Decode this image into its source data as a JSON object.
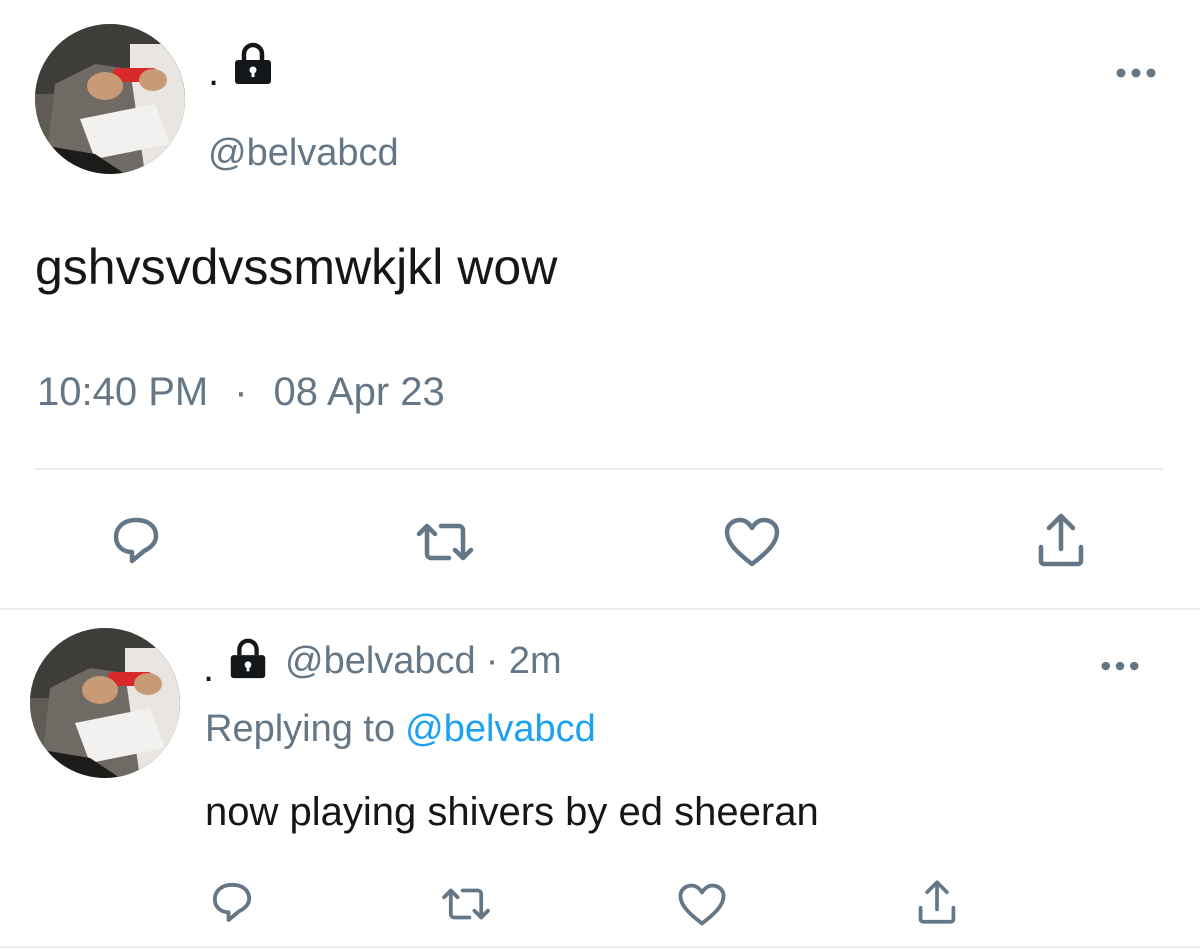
{
  "main_tweet": {
    "display_name": ".",
    "handle": "@belvabcd",
    "text": "gshvsvdvssmwkjkl wow",
    "time": "10:40 PM",
    "separator": "·",
    "date": "08 Apr 23",
    "icons": {
      "lock": "lock-icon",
      "more": "more-icon",
      "reply": "reply-icon",
      "retweet": "retweet-icon",
      "like": "heart-icon",
      "share": "share-icon"
    }
  },
  "reply_tweet": {
    "display_name": ".",
    "handle": "@belvabcd",
    "age": "· 2m",
    "replying_prefix": "Replying to",
    "replying_handle": "@belvabcd",
    "text": "now playing shivers by ed sheeran"
  },
  "colors": {
    "text": "#14171a",
    "muted": "#657786",
    "link": "#1da1f2",
    "divider": "#e6ecf0"
  }
}
